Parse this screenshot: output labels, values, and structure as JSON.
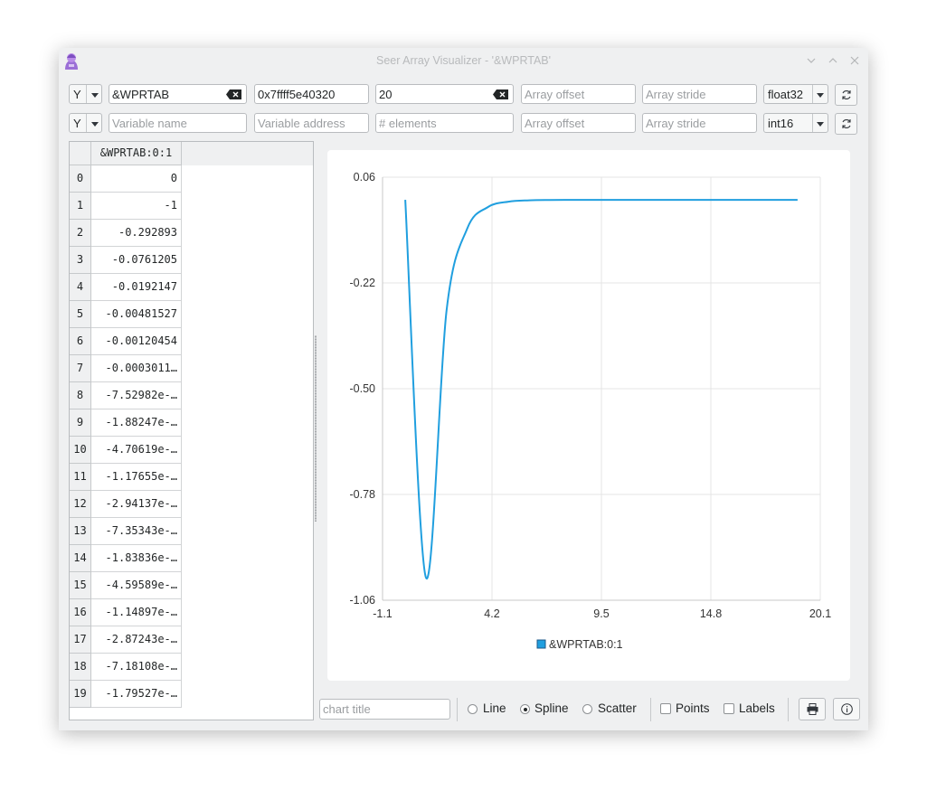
{
  "window": {
    "title": "Seer Array Visualizer - '&WPRTAB'"
  },
  "rows": [
    {
      "axis": "Y",
      "variable_name": "&WPRTAB",
      "variable_placeholder": "Variable name",
      "address": "0x7ffff5e40320",
      "address_placeholder": "Variable address",
      "elements": "20",
      "elements_placeholder": "# elements",
      "offset_placeholder": "Array offset",
      "stride_placeholder": "Array stride",
      "type": "float32"
    },
    {
      "axis": "Y",
      "variable_name": "",
      "variable_placeholder": "Variable name",
      "address": "",
      "address_placeholder": "Variable address",
      "elements": "",
      "elements_placeholder": "# elements",
      "offset_placeholder": "Array offset",
      "stride_placeholder": "Array stride",
      "type": "int16"
    }
  ],
  "table": {
    "column_header": "&WPRTAB:0:1",
    "row_indices": [
      "0",
      "1",
      "2",
      "3",
      "4",
      "5",
      "6",
      "7",
      "8",
      "9",
      "10",
      "11",
      "12",
      "13",
      "14",
      "15",
      "16",
      "17",
      "18",
      "19"
    ],
    "values": [
      "0",
      "-1",
      "-0.292893",
      "-0.0761205",
      "-0.0192147",
      "-0.00481527",
      "-0.00120454",
      "-0.0003011…",
      "-7.52982e-…",
      "-1.88247e-…",
      "-4.70619e-…",
      "-1.17655e-…",
      "-2.94137e-…",
      "-7.35343e-…",
      "-1.83836e-…",
      "-4.59589e-…",
      "-1.14897e-…",
      "-2.87243e-…",
      "-7.18108e-…",
      "-1.79527e-…"
    ]
  },
  "chart_data": {
    "type": "line",
    "title": "",
    "xlabel": "",
    "ylabel": "",
    "xlim": [
      -1.1,
      20.1
    ],
    "ylim": [
      -1.06,
      0.06
    ],
    "x_ticks": [
      "-1.1",
      "4.2",
      "9.5",
      "14.8",
      "20.1"
    ],
    "y_ticks": [
      "0.06",
      "-0.22",
      "-0.50",
      "-0.78",
      "-1.06"
    ],
    "grid": true,
    "legend": "bottom",
    "interpolation": "spline",
    "series": [
      {
        "name": "&WPRTAB:0:1",
        "color": "#209fdf",
        "x": [
          0,
          1,
          2,
          3,
          4,
          5,
          6,
          7,
          8,
          9,
          10,
          11,
          12,
          13,
          14,
          15,
          16,
          17,
          18,
          19
        ],
        "y": [
          0,
          -1,
          -0.292893,
          -0.0761205,
          -0.0192147,
          -0.00481527,
          -0.00120454,
          -0.0003011,
          -7.53e-05,
          -1.88e-05,
          -4.7e-06,
          -1.2e-06,
          -3e-07,
          -7e-08,
          -2e-08,
          0,
          0,
          0,
          0,
          0
        ]
      }
    ]
  },
  "bottom_bar": {
    "title_placeholder": "chart title",
    "line_label": "Line",
    "spline_label": "Spline",
    "scatter_label": "Scatter",
    "points_label": "Points",
    "labels_label": "Labels"
  }
}
